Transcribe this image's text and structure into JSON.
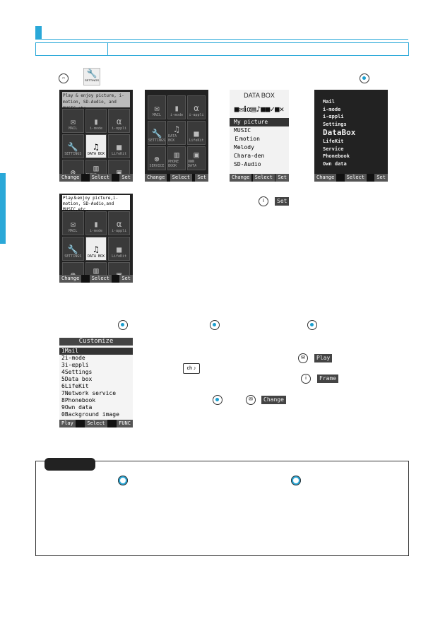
{
  "screens": {
    "s1": {
      "banner": "Play & enjoy picture, i-motion, SD-Audio, and MUSIC etc.",
      "cells": [
        "MAIL",
        "i-mode",
        "i-αppli",
        "SETTINGS",
        "DATA BOX",
        "LifeKit",
        "SERVICE",
        "PHONE BOOK",
        "OWN DATA"
      ],
      "soft": [
        "Change",
        "Select",
        "Set"
      ]
    },
    "s2": {
      "cells": [
        "MAIL",
        "i-mode",
        "i-αppli",
        "SETTINGS",
        "DATA BOX",
        "LifeKit",
        "SERVICE",
        "PHONE BOOK",
        "OWN DATA"
      ],
      "soft": [
        "Change",
        "Select",
        "Set"
      ]
    },
    "s3": {
      "title": "DATA BOX",
      "items": [
        "My picture",
        "MUSIC",
        "Ｅmotion",
        "Melody",
        "Chara-den",
        "SD-Audio"
      ],
      "soft": [
        "Change",
        "Select",
        "Set"
      ]
    },
    "s4": {
      "items": [
        "Mail",
        "i-mode",
        "i-αppli",
        "Settings",
        "DataBox",
        "LifeKit",
        "Service",
        "Phonebook",
        "Own data"
      ],
      "soft": [
        "Change",
        "Select",
        "Set"
      ]
    },
    "s5": {
      "banner": "Play＆enjoy picture,i-motion, SD-Audio,and MUSIC,etc.",
      "cells": [
        "MAIL",
        "i-mode",
        "i-αppli",
        "SETTINGS",
        "DATA BOX",
        "LifeKit",
        "SERVICE",
        "PHONE BOOK",
        "OWN DATA"
      ],
      "soft": [
        "Change",
        "Select",
        "Set"
      ]
    },
    "customize": {
      "title": "Customize",
      "items": [
        "1Mail",
        "2i-mode",
        "3i-αppli",
        "4Settings",
        "5Data box",
        "6LifeKit",
        "7Network service",
        "8Phonebook",
        "9Own data",
        "0Background image"
      ],
      "soft": [
        "Play",
        "Select",
        "FUNC"
      ]
    }
  },
  "keys": {
    "settings_icon": "SETTINGS",
    "set": "Set",
    "play": "Play",
    "frame": "Frame",
    "change": "Change"
  },
  "accent": "#2aa8d8"
}
